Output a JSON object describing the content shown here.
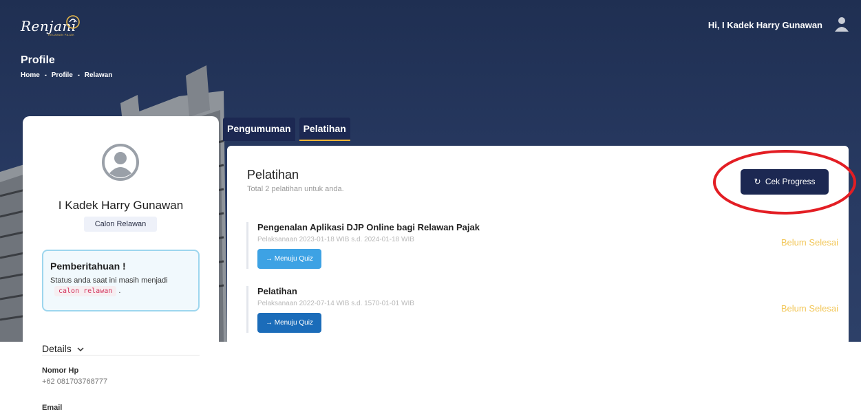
{
  "header": {
    "logo_text": "Renjani",
    "logo_sub": "RELAWAN PAJAK",
    "greeting": "Hi, I Kadek Harry Gunawan",
    "page_title": "Profile",
    "breadcrumb": [
      "Home",
      "-",
      "Profile",
      "-",
      "Relawan"
    ]
  },
  "profile": {
    "name": "I Kadek Harry Gunawan",
    "role": "Calon Relawan",
    "notice_title": "Pemberitahuan !",
    "notice_text": "Status anda saat ini masih menjadi",
    "notice_code": "calon relawan",
    "notice_end": ".",
    "details_title": "Details",
    "fields": [
      {
        "label": "Nomor Hp",
        "value": "+62 081703768777"
      },
      {
        "label": "Email",
        "value": ""
      }
    ]
  },
  "tabs": [
    {
      "label": "Pengumuman",
      "active": false
    },
    {
      "label": "Pelatihan",
      "active": true
    }
  ],
  "main": {
    "title": "Pelatihan",
    "subtitle": "Total 2 pelatihan untuk anda.",
    "progress_button": "Cek Progress",
    "items": [
      {
        "title": "Pengenalan Aplikasi DJP Online bagi Relawan Pajak",
        "date": "Pelaksanaan 2023-01-18 WIB s.d. 2024-01-18 WIB",
        "button": "→ Menuju Quiz",
        "status": "Belum Selesai"
      },
      {
        "title": "Pelatihan",
        "date": "Pelaksanaan 2022-07-14 WIB s.d. 1570-01-01 WIB",
        "button": "→ Menuju Quiz",
        "status": "Belum Selesai"
      }
    ]
  },
  "colors": {
    "navy": "#1c2852",
    "accent": "#f0b535",
    "status_pending": "#f2c75a",
    "quiz_light": "#3da2e4",
    "quiz_dark": "#1b6cb9",
    "highlight": "#e31e24"
  },
  "icons": [
    "user-icon",
    "avatar-icon",
    "chevron-down-icon",
    "refresh-icon",
    "arrow-right-icon"
  ]
}
